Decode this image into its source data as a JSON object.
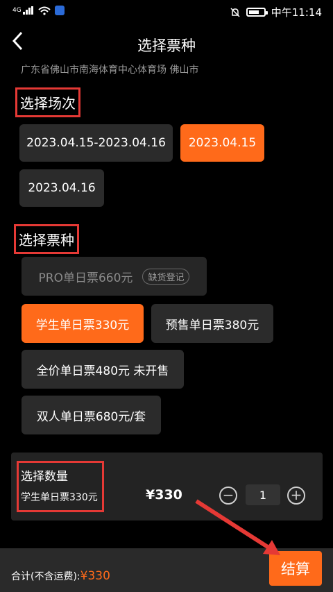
{
  "status": {
    "network": "4G",
    "time": "中午11:14"
  },
  "header": {
    "title": "选择票种"
  },
  "venue": "广东省佛山市南海体育中心体育场 佛山市",
  "session": {
    "title": "选择场次",
    "options": [
      "2023.04.15-2023.04.16",
      "2023.04.15",
      "2023.04.16"
    ]
  },
  "tickets": {
    "title": "选择票种",
    "pro": "PRO单日票660元",
    "pro_tag": "缺货登记",
    "student": "学生单日票330元",
    "presale": "预售单日票380元",
    "full": "全价单日票480元 未开售",
    "double": "双人单日票680元/套"
  },
  "quantity": {
    "title": "选择数量",
    "subtitle": "学生单日票330元",
    "price": "¥330",
    "value": "1",
    "minus": "−",
    "plus": "+"
  },
  "footer": {
    "total_label": "合计(不含运费):",
    "total_value": "¥330",
    "checkout": "结算"
  },
  "colors": {
    "accent": "#ff6a1a",
    "annotation": "#e53935"
  }
}
